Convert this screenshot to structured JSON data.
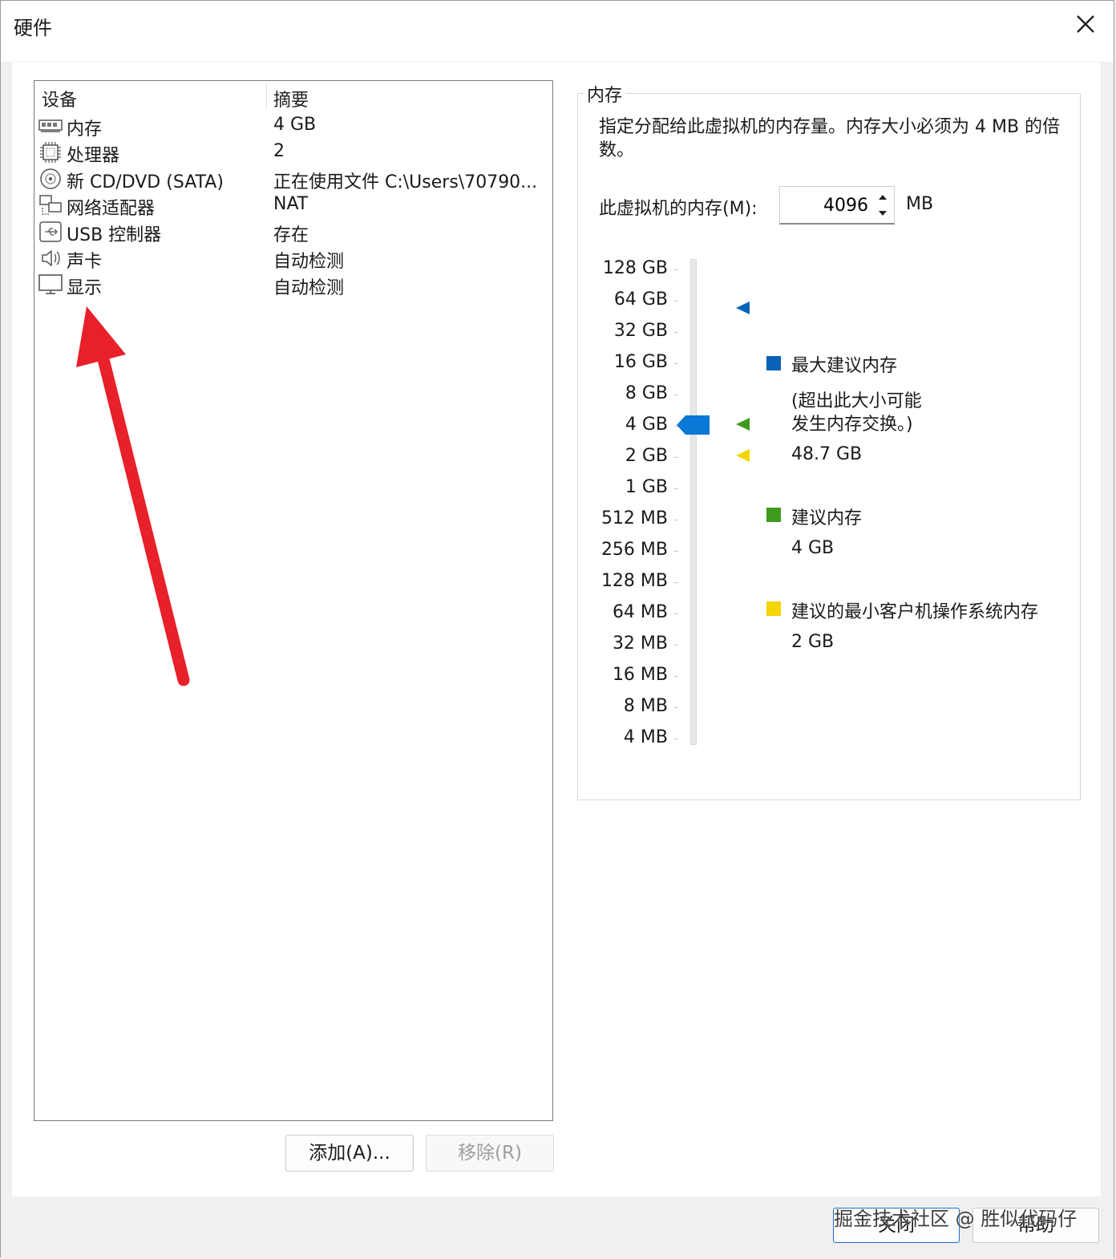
{
  "window": {
    "title": "硬件"
  },
  "device_list": {
    "headers": {
      "device": "设备",
      "summary": "摘要"
    },
    "rows": [
      {
        "icon": "memory-icon",
        "name": "内存",
        "summary": "4 GB"
      },
      {
        "icon": "processor-icon",
        "name": "处理器",
        "summary": "2"
      },
      {
        "icon": "cd-dvd-icon",
        "name": "新 CD/DVD (SATA)",
        "summary": "正在使用文件 C:\\Users\\70790..."
      },
      {
        "icon": "network-adapter-icon",
        "name": "网络适配器",
        "summary": "NAT"
      },
      {
        "icon": "usb-icon",
        "name": "USB 控制器",
        "summary": "存在"
      },
      {
        "icon": "speaker-icon",
        "name": "声卡",
        "summary": "自动检测"
      },
      {
        "icon": "monitor-icon",
        "name": "显示",
        "summary": "自动检测"
      }
    ]
  },
  "buttons": {
    "add": "添加(A)...",
    "remove": "移除(R)"
  },
  "memory": {
    "group_title": "内存",
    "description": "指定分配给此虚拟机的内存量。内存大小必须为 4 MB 的倍数。",
    "field_label": "此虚拟机的内存(M):",
    "value": "4096",
    "unit": "MB",
    "scale_labels": [
      "128 GB",
      "64 GB",
      "32 GB",
      "16 GB",
      "8 GB",
      "4 GB",
      "2 GB",
      "1 GB",
      "512 MB",
      "256 MB",
      "128 MB",
      "64 MB",
      "32 MB",
      "16 MB",
      "8 MB",
      "4 MB"
    ],
    "selected": "4 GB",
    "legend": {
      "max_title": "最大建议内存",
      "max_note_1": "(超出此大小可能",
      "max_note_2": "发生内存交换。)",
      "max_value": "48.7 GB",
      "recommended_title": "建议内存",
      "recommended_value": "4 GB",
      "min_title": "建议的最小客户机操作系统内存",
      "min_value": "2 GB"
    },
    "colors": {
      "max": "#0a62b8",
      "recommended": "#3f9b1c",
      "min": "#f5d400",
      "thumb": "#0a78d7"
    }
  },
  "footer": {
    "close": "关闭",
    "help": "帮助"
  },
  "watermark": "掘金技术社区 @ 胜似代码仔"
}
